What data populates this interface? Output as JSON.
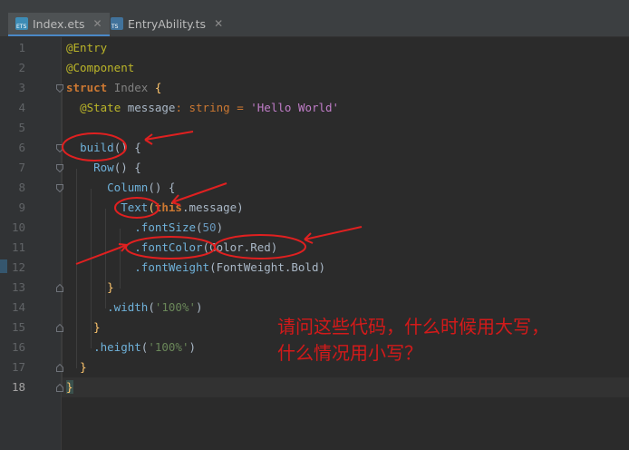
{
  "tabs": [
    {
      "label": "Index.ets",
      "icon": "ets-file-icon",
      "icon_text": "ETS",
      "active": true
    },
    {
      "label": "EntryAbility.ts",
      "icon": "ts-file-icon",
      "icon_text": "TS",
      "active": false
    }
  ],
  "line_numbers": [
    "1",
    "2",
    "3",
    "4",
    "5",
    "6",
    "7",
    "8",
    "9",
    "10",
    "11",
    "12",
    "13",
    "14",
    "15",
    "16",
    "17",
    "18"
  ],
  "code": {
    "l1": "@Entry",
    "l2": "@Component",
    "l3_kw": "struct",
    "l3_name": "Index",
    "l3_brace": "{",
    "l4_ann": "@State",
    "l4_field": "message",
    "l4_colon": ":",
    "l4_type": "string",
    "l4_eq": "=",
    "l4_str": "'Hello World'",
    "l6_fn": "build",
    "l6_rest": "() {",
    "l7_comp": "Row",
    "l7_rest": "() {",
    "l8_comp": "Column",
    "l8_rest": "() {",
    "l9_comp": "Text",
    "l9_paren": "(",
    "l9_this": "this",
    "l9_rest": ".message)",
    "l10_attr": ".fontSize",
    "l10_open": "(",
    "l10_num": "50",
    "l10_close": ")",
    "l11_attr": ".fontColor",
    "l11_arg": "(Color.Red)",
    "l12_attr": ".fontWeight",
    "l12_arg": "(FontWeight.Bold)",
    "l13": "}",
    "l14_attr": ".width",
    "l14_open": "(",
    "l14_str": "'100%'",
    "l14_close": ")",
    "l15": "}",
    "l16_attr": ".height",
    "l16_open": "(",
    "l16_str": "'100%'",
    "l16_close": ")",
    "l17": "}",
    "l18": "}"
  },
  "annotation": {
    "question": "请问这些代码，什么时候用大写，\n什么情况用小写？",
    "color": "#d31a1a"
  },
  "colors": {
    "editor_bg": "#2b2b2b",
    "gutter_bg": "#313335",
    "keyword": "#cc7832",
    "annotation": "#bbb529",
    "string": "#6a8759",
    "number": "#6897bb",
    "field": "#9876aa",
    "function": "#ffc66d"
  }
}
